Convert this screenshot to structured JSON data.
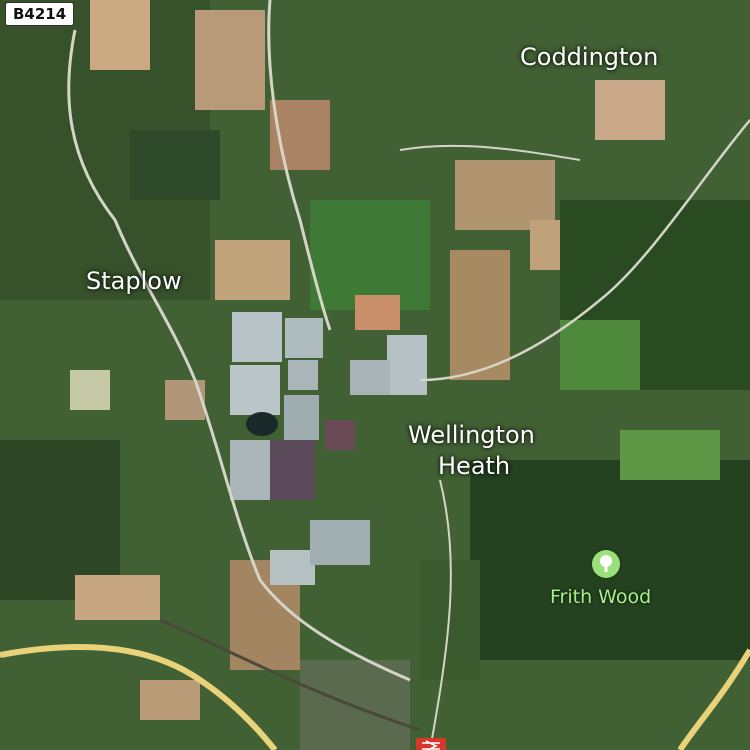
{
  "map": {
    "road_shield": "B4214",
    "places": [
      {
        "name": "Coddington"
      },
      {
        "name": "Staplow"
      },
      {
        "name": "Wellington"
      },
      {
        "name": "Heath"
      }
    ],
    "poi": {
      "name": "Frith Wood",
      "icon": "tree-icon",
      "color": "#a6f08a"
    },
    "station": {
      "icon": "railway-station-icon",
      "color": "#d9362b"
    },
    "colors": {
      "road_yellow": "#e8d27a",
      "road_white": "#d8d8cc",
      "greenhouse": "#b9c4c7",
      "field_dark": "#2f4a24",
      "field_light": "#5e8a3c",
      "field_tan": "#b89a70"
    }
  }
}
